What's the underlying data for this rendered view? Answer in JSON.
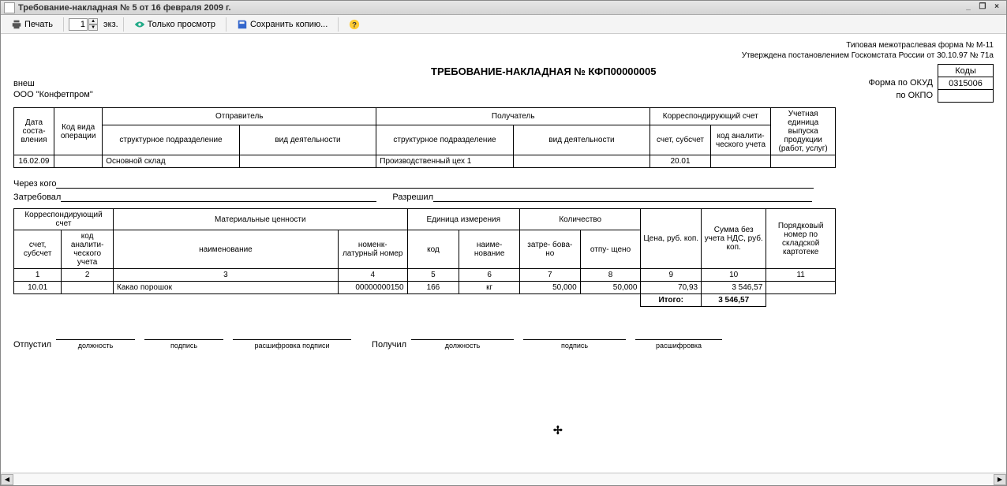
{
  "titlebar": {
    "text": "Требование-накладная № 5 от 16 февраля 2009 г.",
    "min": "_",
    "restore": "❐",
    "close": "×"
  },
  "toolbar": {
    "print": "Печать",
    "copies_value": "1",
    "copies_label": "экз.",
    "view_only": "Только просмотр",
    "save_copy": "Сохранить копию...",
    "help": "?"
  },
  "meta": {
    "line1": "Типовая межотраслевая форма № М-11",
    "line2": "Утверждена постановлением Госкомстата России от 30.10.97 № 71а",
    "codes_hdr": "Коды",
    "okud_label": "Форма по ОКУД",
    "okud_value": "0315006",
    "okpo_label": "по ОКПО",
    "okpo_value": ""
  },
  "doc": {
    "title": "ТРЕБОВАНИЕ-НАКЛАДНАЯ № КФП00000005",
    "vnesh": "внеш",
    "org": "ООО \"Конфетпром\""
  },
  "main_hdr": {
    "date": "Дата соста- вления",
    "op_code": "Код вида операции",
    "sender": "Отправитель",
    "receiver": "Получатель",
    "corr": "Корреспондирующий счет",
    "unit": "Учетная единица выпуска продукции (работ, услуг)",
    "struct": "структурное подразделение",
    "activity": "вид деятельности",
    "account": "счет, субсчет",
    "analytic": "код аналити- ческого учета"
  },
  "main_row": {
    "date": "16.02.09",
    "sender_struct": "Основной склад",
    "receiver_struct": "Производственный цех 1",
    "account": "20.01"
  },
  "sig1": {
    "via": "Через кого",
    "requested": "Затребовал",
    "allowed": "Разрешил"
  },
  "items_hdr": {
    "corr": "Корреспондирующий счет",
    "materials": "Материальные ценности",
    "unit": "Единица измерения",
    "qty": "Количество",
    "price": "Цена, руб. коп.",
    "sum": "Сумма без учета НДС, руб. коп.",
    "order": "Порядковый номер по складской картотеке",
    "account": "счет, субсчет",
    "analytic": "код аналити- ческого учета",
    "name": "наименование",
    "nomen": "номенк- латурный номер",
    "code": "код",
    "unit_name": "наиме- нование",
    "requested": "затре- бова- но",
    "released": "отпу- щено"
  },
  "col_nums": {
    "c1": "1",
    "c2": "2",
    "c3": "3",
    "c4": "4",
    "c5": "5",
    "c6": "6",
    "c7": "7",
    "c8": "8",
    "c9": "9",
    "c10": "10",
    "c11": "11"
  },
  "items": [
    {
      "account": "10.01",
      "analytic": "",
      "name": "Какао порошок",
      "nomen": "00000000150",
      "code": "166",
      "unit_name": "кг",
      "requested": "50,000",
      "released": "50,000",
      "price": "70,93",
      "sum": "3 546,57",
      "order": ""
    }
  ],
  "total": {
    "label": "Итого:",
    "value": "3 546,57"
  },
  "sig2": {
    "released": "Отпустил",
    "received": "Получил",
    "position": "должность",
    "signature": "подпись",
    "decoding": "расшифровка подписи",
    "decoding2": "расшифровка"
  }
}
